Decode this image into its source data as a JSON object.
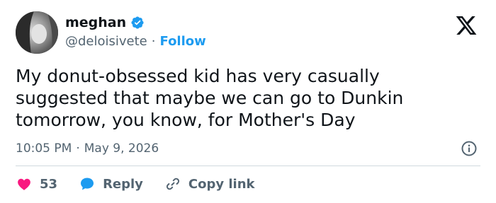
{
  "author": {
    "name": "meghan",
    "handle": "@deloisivete",
    "separator": "·",
    "follow_label": "Follow"
  },
  "tweet": {
    "text": "My donut-obsessed kid has very casually\nsuggested that maybe we can go to Dunkin\ntomorrow, you know, for Mother's Day",
    "time": "10:05 PM",
    "date": "May 9, 2026",
    "separator": "·"
  },
  "actions": {
    "like_count": "53",
    "reply_label": "Reply",
    "copy_link_label": "Copy link"
  },
  "colors": {
    "accent": "#1d9bf0",
    "like": "#f91880",
    "text": "#0f1419",
    "muted": "#536471",
    "divider": "#cfd9de"
  },
  "icons": {
    "verified": "verified-badge-icon",
    "logo": "x-logo-icon",
    "info": "info-icon",
    "like": "heart-icon",
    "reply": "speech-bubble-icon",
    "copy": "link-icon"
  }
}
